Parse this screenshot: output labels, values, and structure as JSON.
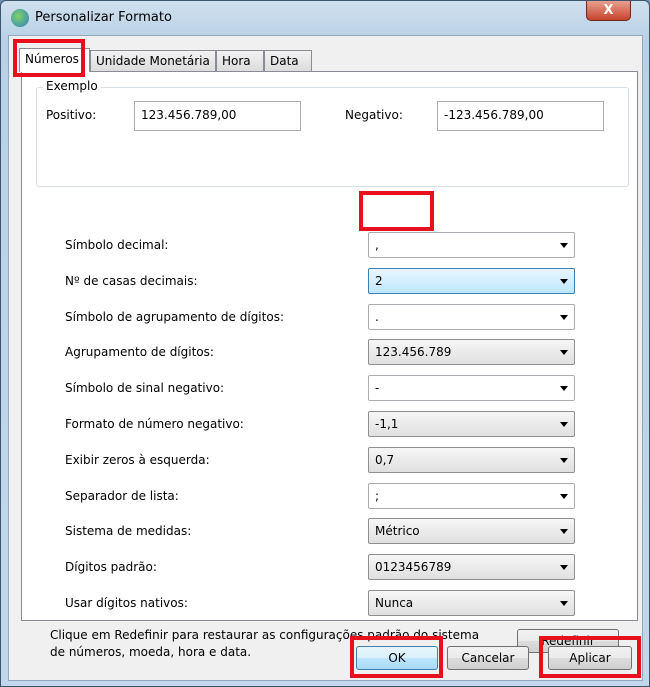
{
  "window": {
    "title": "Personalizar Formato",
    "close_label": "X"
  },
  "tabs": [
    {
      "label": "Números",
      "active": true
    },
    {
      "label": "Unidade Monetária"
    },
    {
      "label": "Hora"
    },
    {
      "label": "Data"
    }
  ],
  "example": {
    "group_label": "Exemplo",
    "positive_label": "Positivo:",
    "positive_value": "123.456.789,00",
    "negative_label": "Negativo:",
    "negative_value": "-123.456.789,00"
  },
  "settings": [
    {
      "label": "Símbolo decimal:",
      "value": ",",
      "editable": true
    },
    {
      "label": "Nº de casas decimais:",
      "value": "2",
      "focused": true
    },
    {
      "label": "Símbolo de agrupamento de dígitos:",
      "value": ".",
      "editable": true
    },
    {
      "label": "Agrupamento de dígitos:",
      "value": "123.456.789"
    },
    {
      "label": "Símbolo de sinal negativo:",
      "value": "-",
      "editable": true
    },
    {
      "label": "Formato de número negativo:",
      "value": "-1,1"
    },
    {
      "label": "Exibir zeros à esquerda:",
      "value": "0,7"
    },
    {
      "label": "Separador de lista:",
      "value": ";",
      "editable": true
    },
    {
      "label": "Sistema de medidas:",
      "value": "Métrico"
    },
    {
      "label": "Dígitos padrão:",
      "value": "0123456789"
    },
    {
      "label": "Usar dígitos nativos:",
      "value": "Nunca"
    }
  ],
  "info_text_line1": "Clique em Redefinir para restaurar as configurações padrão do sistema",
  "info_text_line2": "de números, moeda, hora e data.",
  "buttons": {
    "reset": "Redefinir",
    "ok": "OK",
    "cancel": "Cancelar",
    "apply": "Aplicar"
  },
  "highlight_color": "#e8101c"
}
